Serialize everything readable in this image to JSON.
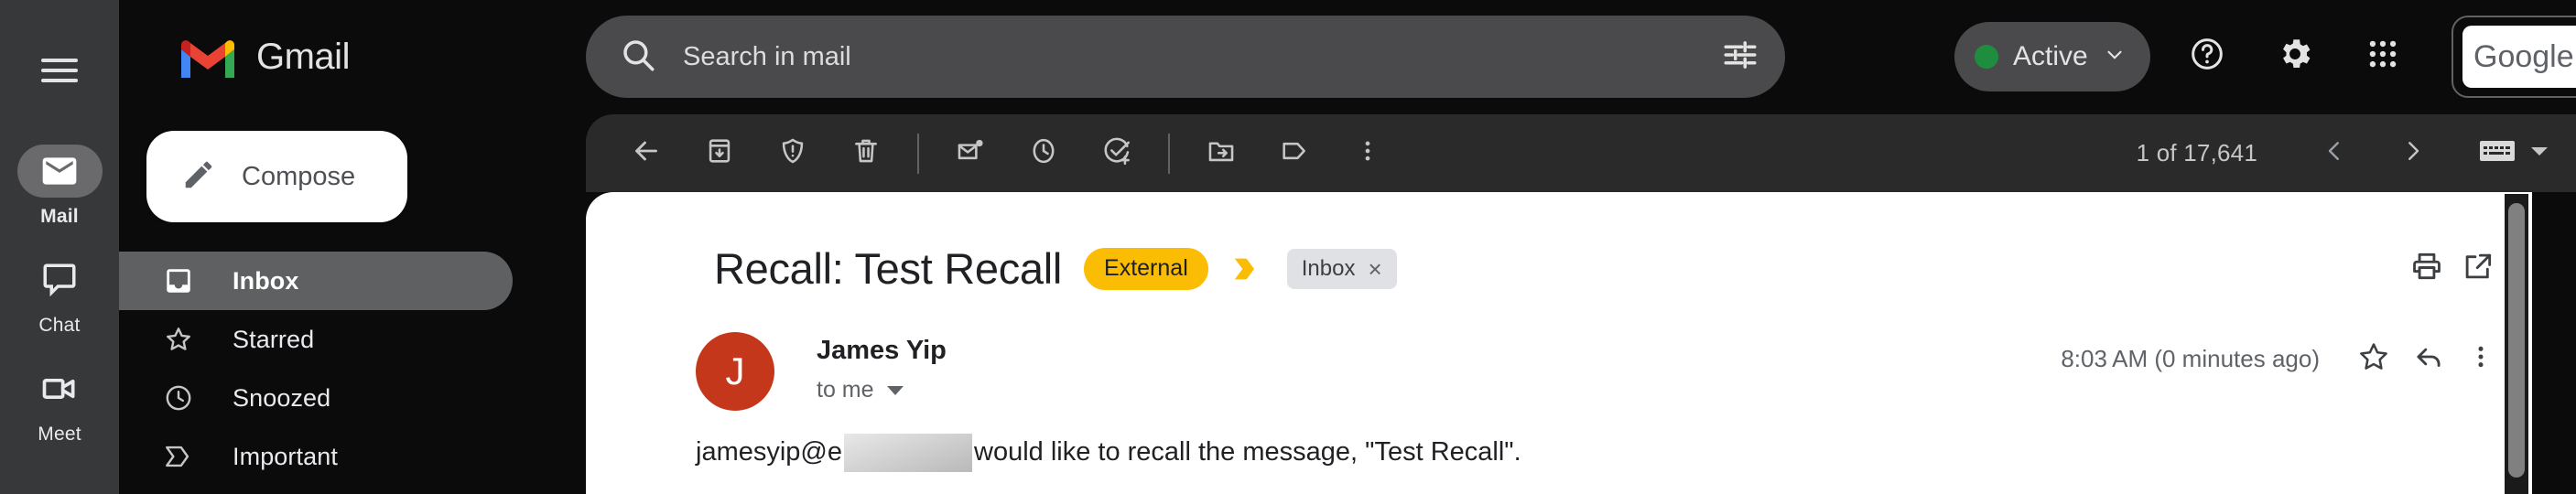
{
  "rail": {
    "menu_icon": "hamburger-menu-icon",
    "items": [
      {
        "label": "Mail",
        "icon": "mail-icon",
        "active": true
      },
      {
        "label": "Chat",
        "icon": "chat-icon",
        "active": false
      },
      {
        "label": "Meet",
        "icon": "meet-icon",
        "active": false
      }
    ]
  },
  "header": {
    "brand": "Gmail",
    "brand_logo_icon": "gmail-m-logo-icon",
    "search": {
      "placeholder": "Search in mail",
      "value": "",
      "icon": "search-icon",
      "filter_icon": "tune-filter-icon"
    },
    "status": {
      "label": "Active",
      "dot_color": "#1e8e3e",
      "caret_icon": "chevron-down-icon"
    },
    "icons": [
      {
        "name": "help-icon"
      },
      {
        "name": "settings-gear-icon"
      },
      {
        "name": "google-apps-grid-icon"
      }
    ],
    "account_badge": {
      "wordmark": "Google",
      "avatar_icon": "user-avatar"
    }
  },
  "sidebar": {
    "compose": {
      "label": "Compose",
      "icon": "pencil-compose-icon"
    },
    "items": [
      {
        "label": "Inbox",
        "icon": "inbox-icon",
        "active": true
      },
      {
        "label": "Starred",
        "icon": "star-icon",
        "active": false
      },
      {
        "label": "Snoozed",
        "icon": "clock-icon",
        "active": false
      },
      {
        "label": "Important",
        "icon": "important-chevron-icon",
        "active": false
      }
    ]
  },
  "toolbar": {
    "buttons": [
      {
        "name": "back-to-inbox-button",
        "icon": "arrow-left-icon"
      },
      {
        "name": "archive-button",
        "icon": "archive-icon"
      },
      {
        "name": "report-spam-button",
        "icon": "report-spam-icon"
      },
      {
        "name": "delete-button",
        "icon": "trash-icon"
      },
      {
        "name": "mark-unread-button",
        "icon": "mark-unread-icon"
      },
      {
        "name": "snooze-button",
        "icon": "clock-icon"
      },
      {
        "name": "add-to-tasks-button",
        "icon": "add-task-icon"
      },
      {
        "name": "move-to-button",
        "icon": "move-to-folder-icon"
      },
      {
        "name": "labels-button",
        "icon": "label-tag-icon"
      },
      {
        "name": "more-options-button",
        "icon": "more-vert-icon"
      }
    ],
    "pagination": {
      "count_text": "1 of 17,641",
      "prev_icon": "chevron-left-icon",
      "next_icon": "chevron-right-icon",
      "keyboard_icon": "keyboard-input-tools-icon",
      "keyboard_caret_icon": "caret-down-icon"
    }
  },
  "message": {
    "subject": "Recall: Test Recall",
    "external_badge": "External",
    "important_marker_icon": "important-marker-icon",
    "label_chip": {
      "text": "Inbox",
      "remove": "×"
    },
    "print_icon": "print-icon",
    "open_new_window_icon": "open-in-new-icon",
    "sender": {
      "avatar_initial": "J",
      "avatar_color": "#c5371b",
      "name": "James Yip",
      "recipient": "to me",
      "details_caret_icon": "caret-down-icon"
    },
    "timestamp": "8:03 AM (0 minutes ago)",
    "star_icon": "star-outline-icon",
    "reply_icon": "reply-arrow-icon",
    "more_icon": "more-vert-icon",
    "body": {
      "prefix": "jamesyip@e",
      "redacted": "redacted-block",
      "suffix": "would like to recall the message, \"Test Recall\"."
    }
  },
  "scrollbar": {
    "name": "vertical-scrollbar"
  }
}
